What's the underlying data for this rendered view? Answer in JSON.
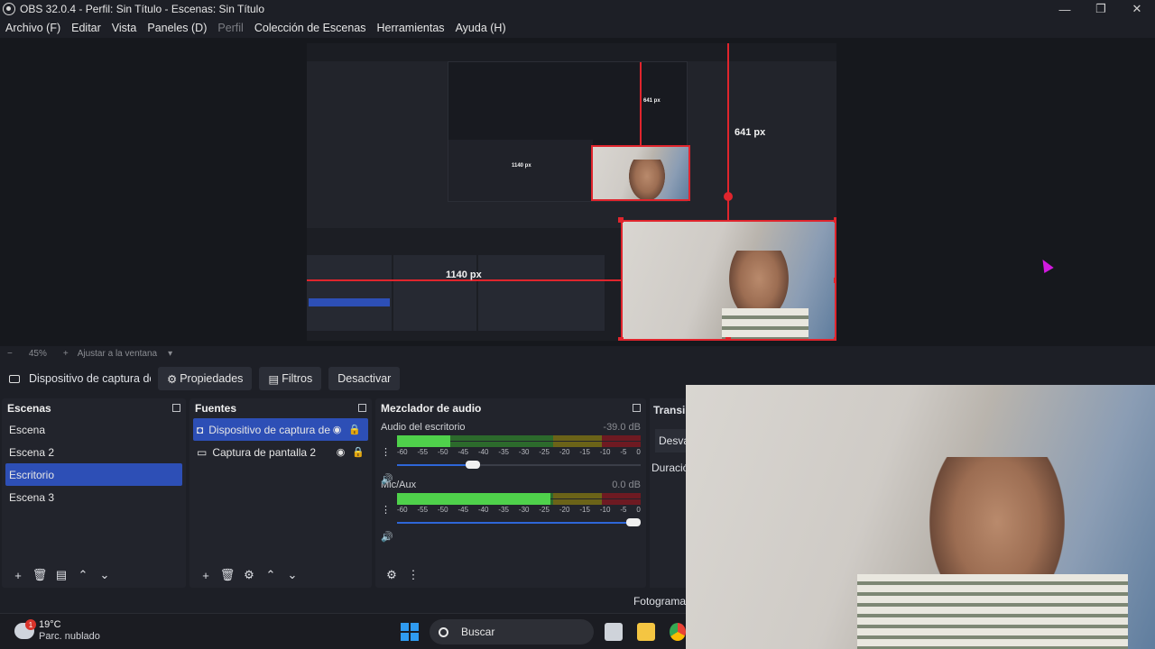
{
  "window": {
    "title": "OBS 32.0.4 - Perfil: Sin Título - Escenas: Sin Título",
    "controls": [
      "—",
      "❐",
      "✕"
    ]
  },
  "menu": [
    "Archivo (F)",
    "Editar",
    "Vista",
    "Paneles (D)",
    "Perfil",
    "Colección de Escenas",
    "Herramientas",
    "Ayuda (H)"
  ],
  "preview": {
    "measure_vertical": "641 px",
    "measure_horizontal": "1140 px",
    "inner_measure_vertical": "641 px",
    "inner_measure_horizontal": "1140 px"
  },
  "zoom": {
    "minus": "−",
    "value": "45%",
    "plus": "+",
    "fit": "Ajustar a la ventana",
    "arrow": "▾"
  },
  "source_toolbar": {
    "source_name": "Dispositivo de captura de v",
    "properties": "Propiedades",
    "filters": "Filtros",
    "deactivate": "Desactivar"
  },
  "scenes": {
    "title": "Escenas",
    "items": [
      "Escena",
      "Escena 2",
      "Escritorio",
      "Escena 3"
    ],
    "selected_index": 2
  },
  "sources": {
    "title": "Fuentes",
    "items": [
      "Dispositivo de captura de",
      "Captura de pantalla 2"
    ]
  },
  "mixer": {
    "title": "Mezclador de audio",
    "channels": [
      {
        "name": "Audio del escritorio",
        "db": "-39.0 dB",
        "level": 0.22,
        "volume": 0.32
      },
      {
        "name": "Mic/Aux",
        "db": "0.0 dB",
        "level": 0.64,
        "volume": 1.0
      }
    ],
    "ticks": [
      "-60",
      "-55",
      "-50",
      "-45",
      "-40",
      "-35",
      "-30",
      "-25",
      "-20",
      "-15",
      "-10",
      "-5",
      "0"
    ]
  },
  "transitions": {
    "title": "Transi",
    "fade": "Desva",
    "duration": "Duració"
  },
  "status": {
    "fps": "Fotograma"
  },
  "taskbar": {
    "weather_temp": "19°C",
    "weather_cond": "Parc. nublado",
    "weather_badge": "1",
    "search": "Buscar"
  },
  "colors": {
    "accent": "#2d4fb6",
    "selection_red": "#e0252d",
    "bg": "#1d1f26"
  }
}
